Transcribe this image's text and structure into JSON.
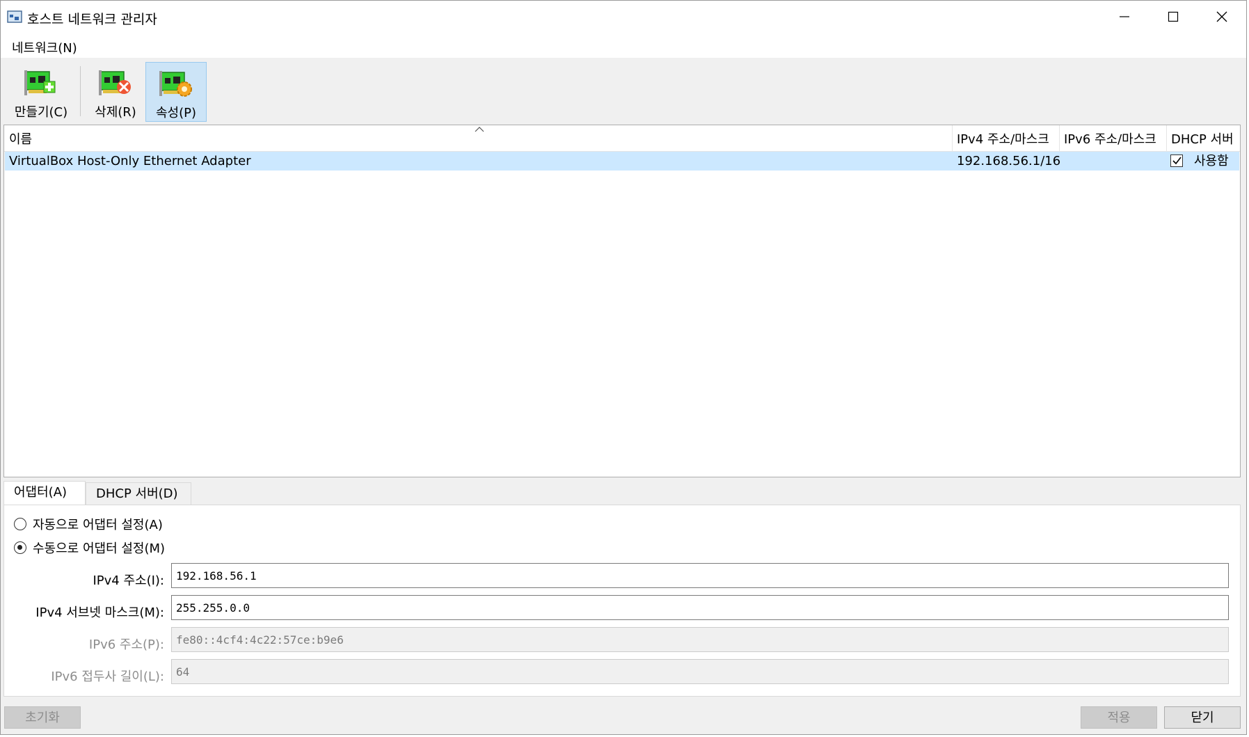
{
  "window": {
    "title": "호스트 네트워크 관리자",
    "minimize_label": "minimize",
    "maximize_label": "maximize",
    "close_label": "close"
  },
  "menu": {
    "network": "네트워크(N)"
  },
  "toolbar": {
    "create": "만들기(C)",
    "delete": "삭제(R)",
    "properties": "속성(P)"
  },
  "table": {
    "columns": [
      "이름",
      "IPv4 주소/마스크",
      "IPv6 주소/마스크",
      "DHCP 서버"
    ],
    "rows": [
      {
        "name": "VirtualBox Host-Only Ethernet Adapter",
        "ipv4": "192.168.56.1/16",
        "ipv6": "",
        "dhcp_checked": true,
        "dhcp_label": "사용함"
      }
    ]
  },
  "tabs": {
    "adapter": "어댑터(A)",
    "dhcp": "DHCP 서버(D)"
  },
  "adapter": {
    "auto_label": "자동으로 어댑터 설정(A)",
    "manual_label": "수동으로 어댑터 설정(M)",
    "selected": "manual",
    "ipv4_address_label": "IPv4 주소(I):",
    "ipv4_address": "192.168.56.1",
    "ipv4_mask_label": "IPv4 서브넷 마스크(M):",
    "ipv4_mask": "255.255.0.0",
    "ipv6_address_label": "IPv6 주소(P):",
    "ipv6_address": "fe80::4cf4:4c22:57ce:b9e6",
    "ipv6_prefix_label": "IPv6 접두사 길이(L):",
    "ipv6_prefix": "64"
  },
  "buttons": {
    "reset": "초기화",
    "apply": "적용",
    "close": "닫기"
  },
  "colors": {
    "selection": "#cce8ff",
    "active_tool": "#cce4f7",
    "window_bg": "#f0f0f0"
  }
}
